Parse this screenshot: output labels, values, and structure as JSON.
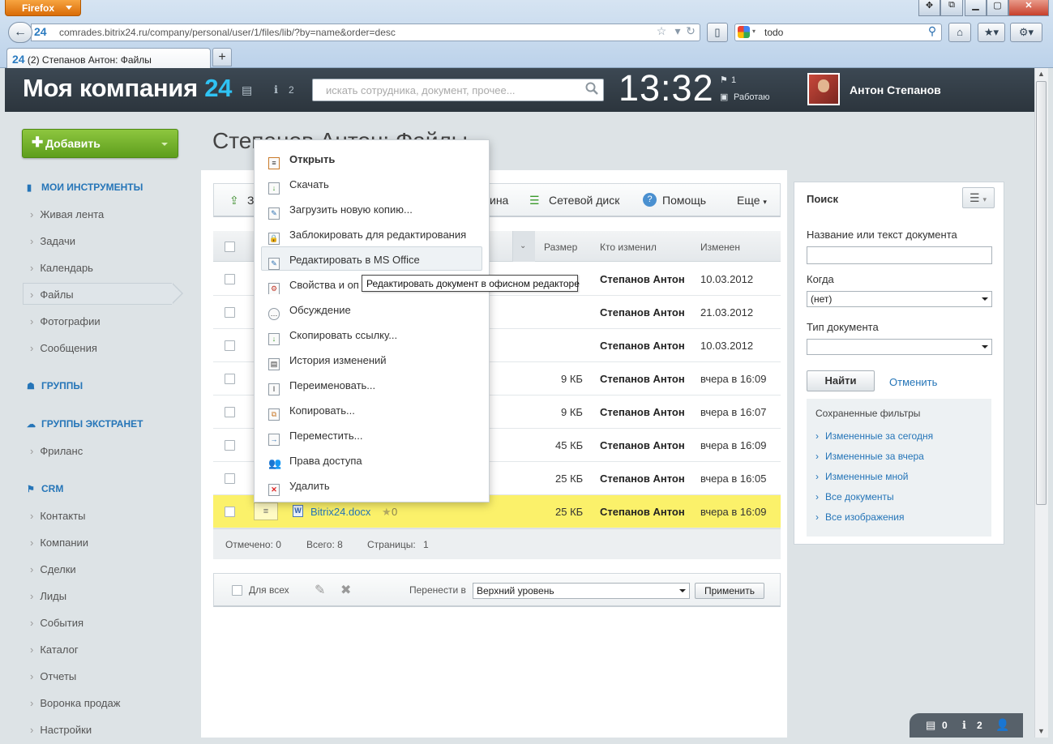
{
  "browser": {
    "app_button": "Firefox",
    "url": "comrades.bitrix24.ru/company/personal/user/1/files/lib/?by=name&order=desc",
    "search_value": "todo",
    "tab_title": "(2) Степанов Антон: Файлы",
    "url_favicon": "24",
    "tab_favicon": "24"
  },
  "header": {
    "logo_text": "Моя компания",
    "logo_number": "24",
    "notifications_count": "2",
    "search_placeholder": "искать сотрудника, документ, прочее...",
    "clock": "13:32",
    "flag_count": "1",
    "work_status": "Работаю",
    "user_name": "Антон Степанов"
  },
  "sidebar": {
    "add_button": "Добавить",
    "sections": [
      {
        "label": "МОИ ИНСТРУМЕНТЫ",
        "items": [
          "Живая лента",
          "Задачи",
          "Календарь",
          "Файлы",
          "Фотографии",
          "Сообщения"
        ]
      },
      {
        "label": "ГРУППЫ",
        "items": []
      },
      {
        "label": "ГРУППЫ ЭКСТРАНЕТ",
        "items": [
          "Фриланс"
        ]
      },
      {
        "label": "CRM",
        "items": [
          "Контакты",
          "Компании",
          "Сделки",
          "Лиды",
          "События",
          "Каталог",
          "Отчеты",
          "Воронка продаж",
          "Настройки"
        ]
      }
    ],
    "active_item": "Файлы"
  },
  "main": {
    "page_title": "Степанов Антон: Файлы",
    "toolbar": {
      "partial_left": "З",
      "partial_mid": "ина",
      "network_drive": "Сетевой диск",
      "help": "Помощь",
      "more": "Еще"
    },
    "columns": {
      "size": "Размер",
      "modified_by": "Кто изменил",
      "modified": "Изменен"
    },
    "rows": [
      {
        "size": "",
        "who": "Степанов Антон",
        "date": "10.03.2012"
      },
      {
        "size": "",
        "who": "Степанов Антон",
        "date": "21.03.2012"
      },
      {
        "size": "",
        "who": "Степанов Антон",
        "date": "10.03.2012"
      },
      {
        "size": "9 КБ",
        "who": "Степанов Антон",
        "date": "вчера в 16:09"
      },
      {
        "size": "9 КБ",
        "who": "Степанов Антон",
        "date": "вчера в 16:07"
      },
      {
        "size": "45 КБ",
        "who": "Степанов Антон",
        "date": "вчера в 16:09"
      },
      {
        "size": "25 КБ",
        "who": "Степанов Антон",
        "date": "вчера в 16:05"
      },
      {
        "size": "25 КБ",
        "who": "Степанов Антон",
        "date": "вчера в 16:09",
        "name": "Bitrix24.docx",
        "rating": "0",
        "highlighted": true
      }
    ],
    "footer": {
      "marked_label": "Отмечено:",
      "marked": "0",
      "total_label": "Всего:",
      "total": "8",
      "pages_label": "Страницы:",
      "pages": "1"
    },
    "group_actions": {
      "for_all": "Для всех",
      "move_to_label": "Перенести в",
      "move_to_value": "Верхний уровень",
      "apply": "Применить"
    }
  },
  "context_menu": {
    "items": [
      "Открыть",
      "Скачать",
      "Загрузить новую копию...",
      "Заблокировать для редактирования",
      "Редактировать в MS Office",
      "Свойства и оп",
      "Обсуждение",
      "Скопировать ссылку...",
      "История изменений",
      "Переименовать...",
      "Копировать...",
      "Переместить...",
      "Права доступа",
      "Удалить"
    ],
    "hovered_index": 4,
    "tooltip": "Редактировать документ в офисном редакторе"
  },
  "search_panel": {
    "title": "Поиск",
    "name_label": "Название или текст документа",
    "name_value": "",
    "when_label": "Когда",
    "when_value": "(нет)",
    "type_label": "Тип документа",
    "type_value": "",
    "find_button": "Найти",
    "cancel_link": "Отменить",
    "saved_title": "Сохраненные фильтры",
    "saved_filters": [
      "Измененные за сегодня",
      "Измененные за вчера",
      "Измененные мной",
      "Все документы",
      "Все изображения"
    ]
  },
  "notify_bar": {
    "messages": "0",
    "notifications": "2"
  },
  "colors": {
    "accent": "#2575b8",
    "highlight_row": "#fbf16a",
    "header": "#333d45",
    "add_button": "#6fad2a"
  }
}
